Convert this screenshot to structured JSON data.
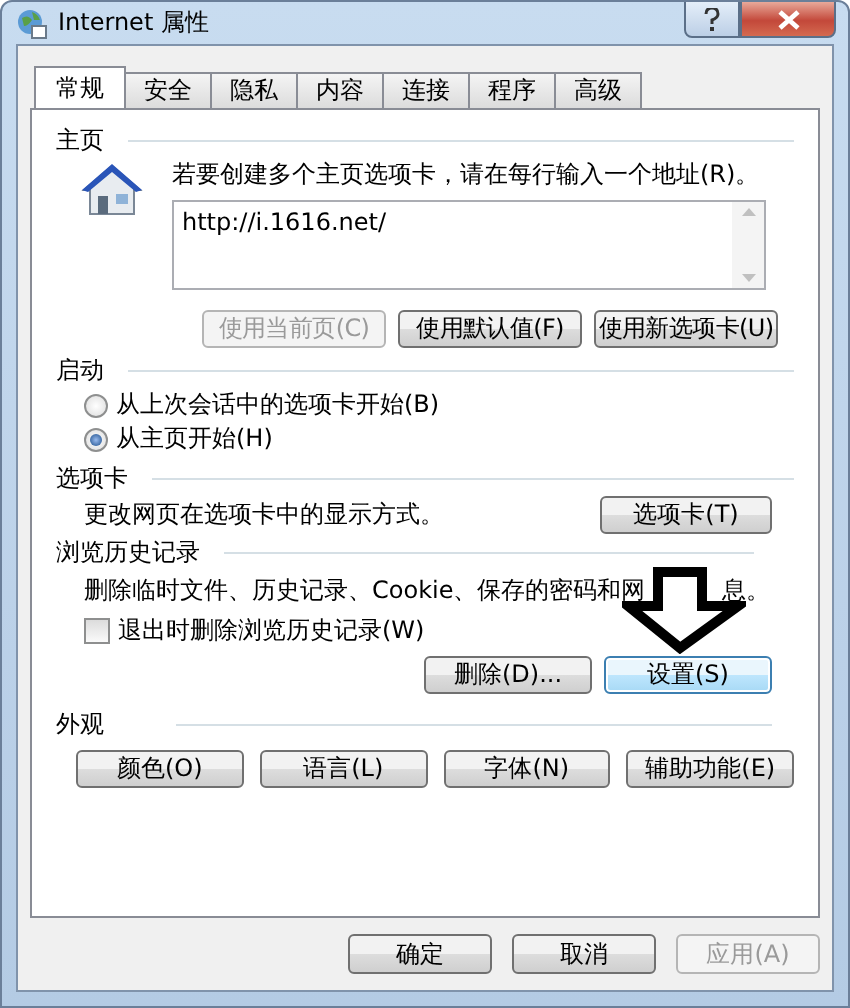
{
  "window": {
    "title": "Internet 属性"
  },
  "tabs": [
    {
      "label": "常规",
      "selected": true
    },
    {
      "label": "安全",
      "selected": false
    },
    {
      "label": "隐私",
      "selected": false
    },
    {
      "label": "内容",
      "selected": false
    },
    {
      "label": "连接",
      "selected": false
    },
    {
      "label": "程序",
      "selected": false
    },
    {
      "label": "高级",
      "selected": false
    }
  ],
  "home_page": {
    "title": "主页",
    "instruction": "若要创建多个主页选项卡，请在每行输入一个地址(R)。",
    "addresses": "http://i.1616.net/",
    "buttons": [
      {
        "label": "使用当前页(C)",
        "disabled": true
      },
      {
        "label": "使用默认值(F)",
        "disabled": false
      },
      {
        "label": "使用新选项卡(U)",
        "disabled": false
      }
    ]
  },
  "startup": {
    "title": "启动",
    "options": [
      {
        "label": "从上次会话中的选项卡开始(B)",
        "selected": false
      },
      {
        "label": "从主页开始(H)",
        "selected": true
      }
    ]
  },
  "tabs_section": {
    "title": "选项卡",
    "description": "更改网页在选项卡中的显示方式。",
    "button": "选项卡(T)"
  },
  "history": {
    "title": "浏览历史记录",
    "description_start": "删除临时文件、历史记录、Cookie、保存的密码和网",
    "description_end": "息。",
    "delete_on_exit": {
      "label": "退出时删除浏览历史记录(W)",
      "checked": false
    },
    "buttons": [
      {
        "label": "删除(D)...",
        "focused": false
      },
      {
        "label": "设置(S)",
        "focused": true
      }
    ]
  },
  "appearance": {
    "title": "外观",
    "buttons": [
      "颜色(O)",
      "语言(L)",
      "字体(N)",
      "辅助功能(E)"
    ]
  },
  "dialog_buttons": [
    {
      "label": "确定",
      "disabled": false
    },
    {
      "label": "取消",
      "disabled": false
    },
    {
      "label": "应用(A)",
      "disabled": true
    }
  ]
}
